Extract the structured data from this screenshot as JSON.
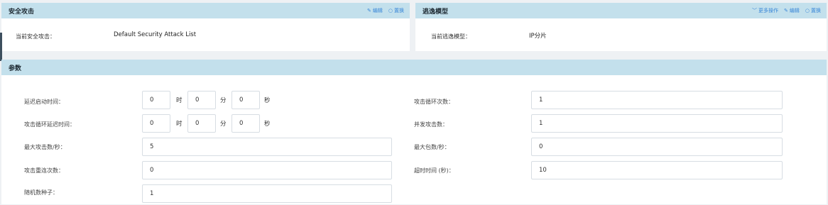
{
  "security_panel": {
    "title": "安全攻击",
    "edit": "编辑",
    "replace": "置换",
    "field_label": "当前安全攻击：",
    "field_value": "Default Security Attack List"
  },
  "evasion_panel": {
    "title": "逃逸模型",
    "more": "更多操作",
    "edit": "编辑",
    "replace": "置换",
    "field_label": "当前逃逸模型：",
    "field_value": "IP分片"
  },
  "params": {
    "title": "参数",
    "units": {
      "hour": "时",
      "minute": "分",
      "second": "秒"
    },
    "delay_start": {
      "label": "延迟启动时间：",
      "h": "0",
      "m": "0",
      "s": "0"
    },
    "loop_delay": {
      "label": "攻击循环延迟时间：",
      "h": "0",
      "m": "0",
      "s": "0"
    },
    "max_attacks": {
      "label": "最大攻击数/秒：",
      "value": "5"
    },
    "reconnect": {
      "label": "攻击重连次数：",
      "value": "0"
    },
    "seed": {
      "label": "随机数种子：",
      "value": "1"
    },
    "loop_count": {
      "label": "攻击循环次数：",
      "value": "1"
    },
    "concurrent": {
      "label": "并发攻击数：",
      "value": "1"
    },
    "max_packets": {
      "label": "最大包数/秒：",
      "value": "0"
    },
    "timeout": {
      "label": "超时时间 (秒)：",
      "value": "10"
    }
  }
}
